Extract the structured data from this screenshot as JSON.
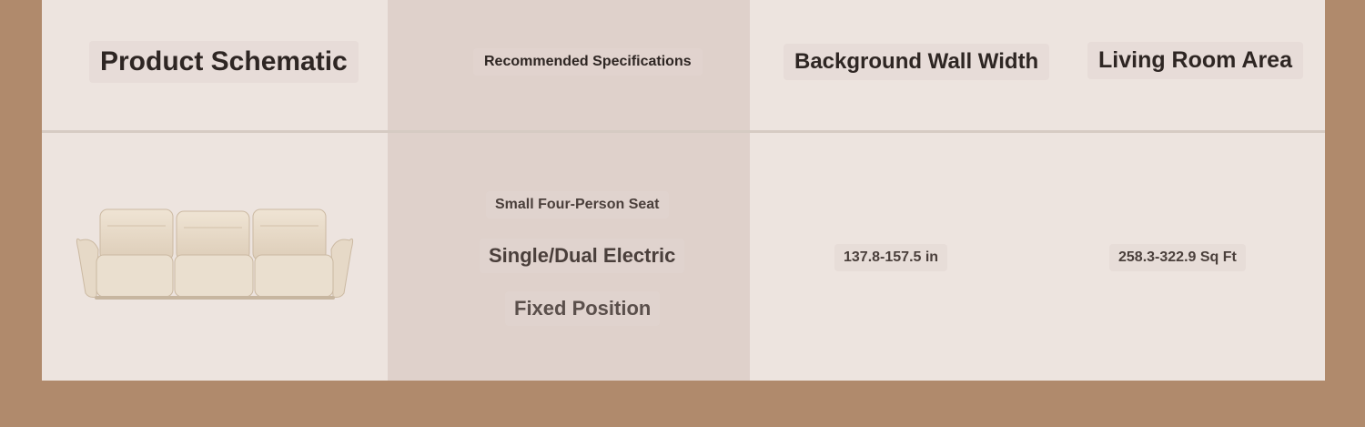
{
  "headers": {
    "product": "Product Schematic",
    "specs": "Recommended Specifications",
    "wall": "Background Wall Width",
    "area": "Living Room Area"
  },
  "row": {
    "seat": "Small Four-Person Seat",
    "electric": "Single/Dual Electric",
    "position": "Fixed Position",
    "wall_width": "137.8-157.5 in",
    "room_area": "258.3-322.9 Sq Ft"
  },
  "image": {
    "icon": "sofa-image"
  },
  "colors": {
    "background": "#b08a6c",
    "panel": "#ede4df",
    "highlight_column": "#dfd1cb",
    "text": "#2e2623"
  }
}
